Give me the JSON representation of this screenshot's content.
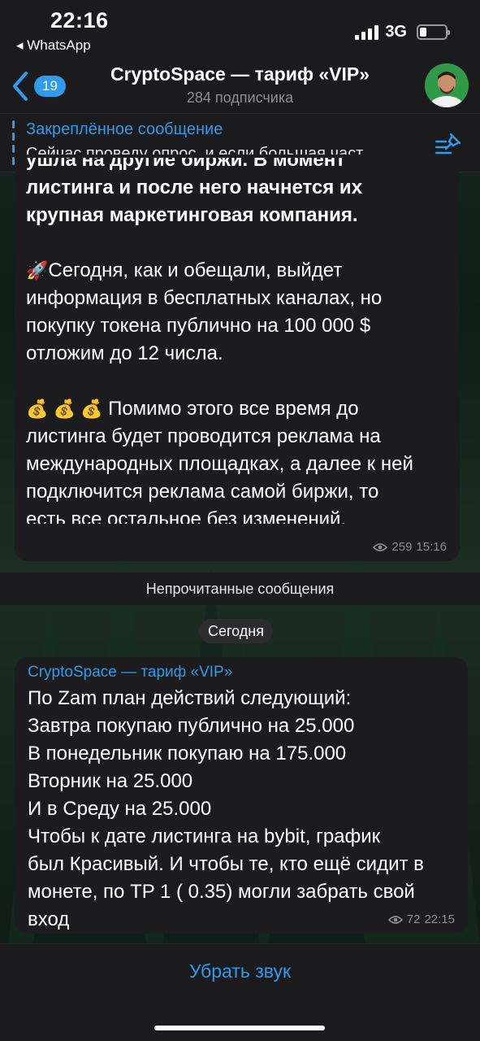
{
  "status": {
    "time": "22:16",
    "back_app": "◂ WhatsApp",
    "network": "3G",
    "battery_level": 0.25
  },
  "header": {
    "unread_count": "19",
    "title": "CryptoSpace — тариф «VIP»",
    "subtitle": "284 подписчика",
    "avatar_icon": "person-avatar"
  },
  "pinned": {
    "title": "Закреплённое сообщение",
    "text": "Сейчас проведу опрос, и если большая част…"
  },
  "message1": {
    "bold_partial": "ушла на другие биржи. В момент",
    "bold_lines": [
      "листинга и после него начнется их",
      "крупная маркетинговая компания."
    ],
    "para2_emoji": "🚀",
    "para2": [
      "Сегодня, как и обещали, выйдет",
      "информация в бесплатных каналах, но",
      "покупку токена публично на 100 000 $",
      "отложим до 12 числа."
    ],
    "para3_emoji": "💰 💰 💰",
    "para3": [
      "Помимо этого все время до",
      "листинга будет проводится реклама на",
      "международных площадках, а далее к ней",
      "подключится реклама самой биржи, то",
      "есть все остальное без изменений."
    ],
    "views": "259",
    "time": "15:16"
  },
  "unread_label": "Непрочитанные сообщения",
  "date_label": "Сегодня",
  "message2": {
    "sender": "CryptoSpace — тариф «VIP»",
    "lines": [
      "По Zam план действий следующий:",
      "Завтра покупаю публично на 25.000",
      "В понедельник покупаю на 175.000",
      "Вторник на 25.000",
      "И в Среду на 25.000",
      "Чтобы к дате листинга на bybit, график",
      "был Красивый. И чтобы те, кто ещё сидит в",
      "монете,  по TP 1 ( 0.35) могли забрать свой",
      "вход"
    ],
    "views": "72",
    "time": "22:15"
  },
  "bottom": {
    "mute_label": "Убрать звук"
  },
  "colors": {
    "accent": "#2f9bea",
    "bubble": "#1c1c1e",
    "bar": "#1b1b1d"
  }
}
